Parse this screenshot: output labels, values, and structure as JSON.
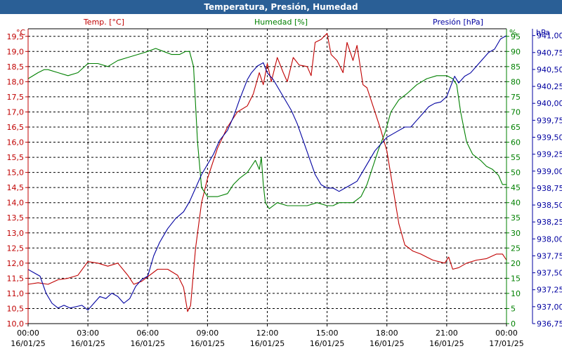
{
  "chart_data": {
    "type": "line",
    "title": "Temperatura, Presión, Humedad",
    "x_tick_labels": [
      [
        "00:00",
        "16/01/25"
      ],
      [
        "03:00",
        "16/01/25"
      ],
      [
        "06:00",
        "16/01/25"
      ],
      [
        "09:00",
        "16/01/25"
      ],
      [
        "12:00",
        "16/01/25"
      ],
      [
        "15:00",
        "16/01/25"
      ],
      [
        "18:00",
        "16/01/25"
      ],
      [
        "21:00",
        "16/01/25"
      ],
      [
        "00:00",
        "17/01/25"
      ]
    ],
    "x_range_hours": [
      0,
      24
    ],
    "grid": true,
    "axes": {
      "temp": {
        "label": "Temp. [°C]",
        "unit": "°C",
        "min": 10.0,
        "max": 19.75,
        "ticks": [
          "10,0",
          "10,5",
          "11,0",
          "11,5",
          "12,0",
          "12,5",
          "13,0",
          "13,5",
          "14,0",
          "14,5",
          "15,0",
          "15,5",
          "16,0",
          "16,5",
          "17,0",
          "17,5",
          "18,0",
          "18,5",
          "19,0",
          "19,5"
        ]
      },
      "hum": {
        "label": "Humedad [%]",
        "unit": "%",
        "min": 0,
        "max": 97.5,
        "ticks": [
          "0",
          "5",
          "10",
          "15",
          "20",
          "25",
          "30",
          "35",
          "40",
          "45",
          "50",
          "55",
          "60",
          "65",
          "70",
          "75",
          "80",
          "85",
          "90",
          "95"
        ]
      },
      "pres": {
        "label": "Presión [hPa]",
        "unit": "hPa",
        "min": 936.75,
        "max": 941.1,
        "ticks": [
          "936,75",
          "937,00",
          "937,25",
          "937,50",
          "937,75",
          "938,00",
          "938,25",
          "938,50",
          "938,75",
          "939,00",
          "939,25",
          "939,50",
          "939,75",
          "940,00",
          "940,25",
          "940,50",
          "940,75",
          "941,00"
        ]
      }
    },
    "series": [
      {
        "name": "Temp. [°C]",
        "color": "#c00000",
        "points": [
          [
            0,
            11.3
          ],
          [
            0.5,
            11.35
          ],
          [
            1,
            11.3
          ],
          [
            1.5,
            11.45
          ],
          [
            2,
            11.5
          ],
          [
            2.5,
            11.6
          ],
          [
            3,
            12.05
          ],
          [
            3.5,
            12.0
          ],
          [
            4,
            11.9
          ],
          [
            4.5,
            12.0
          ],
          [
            5,
            11.6
          ],
          [
            5.3,
            11.3
          ],
          [
            5.7,
            11.4
          ],
          [
            6,
            11.55
          ],
          [
            6.5,
            11.8
          ],
          [
            7,
            11.8
          ],
          [
            7.5,
            11.6
          ],
          [
            7.8,
            11.2
          ],
          [
            8,
            10.4
          ],
          [
            8.15,
            10.6
          ],
          [
            8.4,
            12.5
          ],
          [
            8.7,
            14.0
          ],
          [
            9,
            14.8
          ],
          [
            9.5,
            15.8
          ],
          [
            10,
            16.5
          ],
          [
            10.5,
            17.0
          ],
          [
            11,
            17.2
          ],
          [
            11.3,
            17.6
          ],
          [
            11.6,
            18.3
          ],
          [
            11.8,
            17.9
          ],
          [
            12,
            18.6
          ],
          [
            12.2,
            18.0
          ],
          [
            12.5,
            18.8
          ],
          [
            12.8,
            18.3
          ],
          [
            13,
            18.0
          ],
          [
            13.3,
            18.8
          ],
          [
            13.6,
            18.55
          ],
          [
            14,
            18.5
          ],
          [
            14.2,
            18.2
          ],
          [
            14.4,
            19.3
          ],
          [
            14.7,
            19.4
          ],
          [
            15,
            19.6
          ],
          [
            15.2,
            18.9
          ],
          [
            15.5,
            18.7
          ],
          [
            15.8,
            18.3
          ],
          [
            16,
            19.3
          ],
          [
            16.3,
            18.7
          ],
          [
            16.5,
            19.2
          ],
          [
            16.8,
            17.9
          ],
          [
            17,
            17.8
          ],
          [
            17.3,
            17.2
          ],
          [
            17.7,
            16.4
          ],
          [
            18,
            15.7
          ],
          [
            18.3,
            14.5
          ],
          [
            18.6,
            13.3
          ],
          [
            18.9,
            12.6
          ],
          [
            19.3,
            12.4
          ],
          [
            19.7,
            12.3
          ],
          [
            20,
            12.2
          ],
          [
            20.3,
            12.1
          ],
          [
            20.6,
            12.05
          ],
          [
            20.9,
            12.0
          ],
          [
            21.1,
            12.2
          ],
          [
            21.3,
            11.8
          ],
          [
            21.6,
            11.85
          ],
          [
            22,
            12.0
          ],
          [
            22.5,
            12.1
          ],
          [
            23,
            12.15
          ],
          [
            23.5,
            12.3
          ],
          [
            23.8,
            12.3
          ],
          [
            24,
            12.1
          ]
        ]
      },
      {
        "name": "Humedad [%]",
        "color": "#008000",
        "points": [
          [
            0,
            81
          ],
          [
            0.5,
            83
          ],
          [
            0.8,
            84
          ],
          [
            1,
            84
          ],
          [
            1.5,
            83
          ],
          [
            2,
            82
          ],
          [
            2.5,
            83
          ],
          [
            3,
            86
          ],
          [
            3.5,
            86
          ],
          [
            4,
            85
          ],
          [
            4.5,
            87
          ],
          [
            5,
            88
          ],
          [
            5.5,
            89
          ],
          [
            6,
            90
          ],
          [
            6.4,
            91
          ],
          [
            6.8,
            90
          ],
          [
            7.2,
            89
          ],
          [
            7.6,
            89
          ],
          [
            7.9,
            90
          ],
          [
            8.1,
            90
          ],
          [
            8.3,
            85
          ],
          [
            8.5,
            60
          ],
          [
            8.7,
            45
          ],
          [
            9,
            42
          ],
          [
            9.5,
            42
          ],
          [
            10,
            43
          ],
          [
            10.3,
            46
          ],
          [
            10.6,
            48
          ],
          [
            11,
            50
          ],
          [
            11.2,
            52
          ],
          [
            11.4,
            54
          ],
          [
            11.6,
            51
          ],
          [
            11.7,
            55
          ],
          [
            11.8,
            46
          ],
          [
            11.9,
            40
          ],
          [
            12.1,
            38
          ],
          [
            12.5,
            40
          ],
          [
            13,
            39
          ],
          [
            13.5,
            39
          ],
          [
            14,
            39
          ],
          [
            14.5,
            40
          ],
          [
            15,
            39
          ],
          [
            15.3,
            39
          ],
          [
            15.6,
            40
          ],
          [
            16,
            40
          ],
          [
            16.3,
            40
          ],
          [
            16.7,
            42
          ],
          [
            17,
            46
          ],
          [
            17.3,
            52
          ],
          [
            17.6,
            58
          ],
          [
            17.9,
            63
          ],
          [
            18.2,
            70
          ],
          [
            18.6,
            74
          ],
          [
            19,
            76
          ],
          [
            19.5,
            79
          ],
          [
            20,
            81
          ],
          [
            20.5,
            82
          ],
          [
            21,
            82
          ],
          [
            21.3,
            81
          ],
          [
            21.5,
            79
          ],
          [
            21.7,
            70
          ],
          [
            22,
            60
          ],
          [
            22.3,
            56
          ],
          [
            22.7,
            54
          ],
          [
            23,
            52
          ],
          [
            23.3,
            51
          ],
          [
            23.6,
            49
          ],
          [
            23.8,
            46
          ],
          [
            24,
            46
          ]
        ]
      },
      {
        "name": "Presión [hPa]",
        "color": "#0000a0",
        "points": [
          [
            0,
            937.55
          ],
          [
            0.3,
            937.5
          ],
          [
            0.6,
            937.45
          ],
          [
            0.9,
            937.2
          ],
          [
            1.2,
            937.05
          ],
          [
            1.5,
            936.98
          ],
          [
            1.8,
            937.02
          ],
          [
            2.1,
            936.98
          ],
          [
            2.4,
            937.0
          ],
          [
            2.7,
            937.02
          ],
          [
            3,
            936.95
          ],
          [
            3.3,
            937.05
          ],
          [
            3.6,
            937.15
          ],
          [
            3.9,
            937.12
          ],
          [
            4.2,
            937.2
          ],
          [
            4.5,
            937.15
          ],
          [
            4.8,
            937.05
          ],
          [
            5.1,
            937.12
          ],
          [
            5.4,
            937.3
          ],
          [
            5.7,
            937.4
          ],
          [
            6,
            937.45
          ],
          [
            6.3,
            937.75
          ],
          [
            6.6,
            937.95
          ],
          [
            7,
            938.15
          ],
          [
            7.4,
            938.3
          ],
          [
            7.8,
            938.4
          ],
          [
            8.1,
            938.55
          ],
          [
            8.4,
            938.75
          ],
          [
            8.7,
            938.95
          ],
          [
            9,
            939.1
          ],
          [
            9.3,
            939.25
          ],
          [
            9.6,
            939.45
          ],
          [
            10,
            939.6
          ],
          [
            10.3,
            939.8
          ],
          [
            10.6,
            940.05
          ],
          [
            11,
            940.35
          ],
          [
            11.2,
            940.45
          ],
          [
            11.5,
            940.55
          ],
          [
            11.8,
            940.6
          ],
          [
            12,
            940.45
          ],
          [
            12.3,
            940.35
          ],
          [
            12.6,
            940.2
          ],
          [
            12.9,
            940.05
          ],
          [
            13.2,
            939.9
          ],
          [
            13.5,
            939.7
          ],
          [
            13.8,
            939.45
          ],
          [
            14.1,
            939.2
          ],
          [
            14.4,
            938.95
          ],
          [
            14.7,
            938.8
          ],
          [
            15,
            938.75
          ],
          [
            15.3,
            938.75
          ],
          [
            15.6,
            938.7
          ],
          [
            15.9,
            938.75
          ],
          [
            16.2,
            938.8
          ],
          [
            16.5,
            938.85
          ],
          [
            16.8,
            939.0
          ],
          [
            17.1,
            939.15
          ],
          [
            17.4,
            939.3
          ],
          [
            17.7,
            939.4
          ],
          [
            18,
            939.5
          ],
          [
            18.3,
            939.55
          ],
          [
            18.6,
            939.6
          ],
          [
            18.9,
            939.65
          ],
          [
            19.2,
            939.65
          ],
          [
            19.5,
            939.75
          ],
          [
            19.8,
            939.85
          ],
          [
            20.1,
            939.95
          ],
          [
            20.4,
            940.0
          ],
          [
            20.7,
            940.02
          ],
          [
            21,
            940.1
          ],
          [
            21.2,
            940.25
          ],
          [
            21.4,
            940.4
          ],
          [
            21.6,
            940.3
          ],
          [
            21.9,
            940.4
          ],
          [
            22.2,
            940.45
          ],
          [
            22.5,
            940.55
          ],
          [
            22.8,
            940.65
          ],
          [
            23.1,
            940.75
          ],
          [
            23.4,
            940.8
          ],
          [
            23.7,
            940.95
          ],
          [
            24,
            941.0
          ]
        ]
      }
    ]
  }
}
